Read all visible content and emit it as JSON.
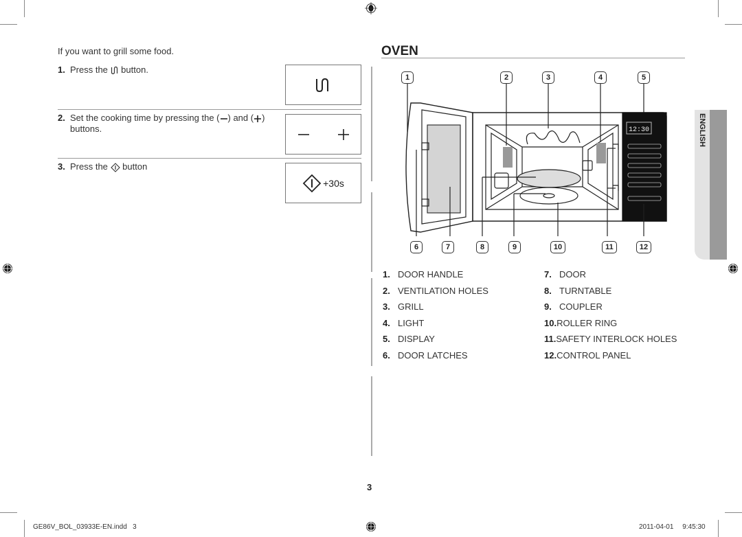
{
  "left": {
    "intro": "If you want to grill some food.",
    "steps": [
      {
        "num": "1.",
        "text_before": "Press the",
        "icon": "grill-icon",
        "text_after": "button.",
        "button_icon": "grill-icon"
      },
      {
        "num": "2.",
        "text_before": "Set the cooking time by pressing the (",
        "icon_minus": "minus-icon",
        "text_mid": ") and (",
        "icon_plus": "plus-icon",
        "text_after": ")",
        "line2": "buttons.",
        "button_icons": [
          "minus-icon",
          "plus-icon"
        ]
      },
      {
        "num": "3.",
        "text_before": "Press the",
        "icon": "start-icon",
        "text_after": "button",
        "button_icon": "start-icon",
        "button_label": "+30s"
      }
    ]
  },
  "right": {
    "title": "OVEN",
    "callouts_top": [
      "1",
      "2",
      "3",
      "4",
      "5"
    ],
    "callouts_bottom": [
      "6",
      "7",
      "8",
      "9",
      "10",
      "11",
      "12"
    ],
    "display_time": "12:30",
    "legend_left": [
      {
        "n": "1.",
        "label": "DOOR HANDLE"
      },
      {
        "n": "2.",
        "label": "VENTILATION HOLES"
      },
      {
        "n": "3.",
        "label": "GRILL"
      },
      {
        "n": "4.",
        "label": "LIGHT"
      },
      {
        "n": "5.",
        "label": "DISPLAY"
      },
      {
        "n": "6.",
        "label": "DOOR LATCHES"
      }
    ],
    "legend_right": [
      {
        "n": "7.",
        "label": "DOOR"
      },
      {
        "n": "8.",
        "label": "TURNTABLE"
      },
      {
        "n": "9.",
        "label": "COUPLER"
      },
      {
        "n": "10.",
        "label": "ROLLER RING"
      },
      {
        "n": "11.",
        "label": "SAFETY INTERLOCK HOLES"
      },
      {
        "n": "12.",
        "label": "CONTROL PANEL"
      }
    ]
  },
  "side_tab": "ENGLISH",
  "page_number": "3",
  "footer": {
    "file": "GE86V_BOL_03933E-EN.indd   3",
    "date": "2011-04-01",
    "time": "9:45:30"
  }
}
